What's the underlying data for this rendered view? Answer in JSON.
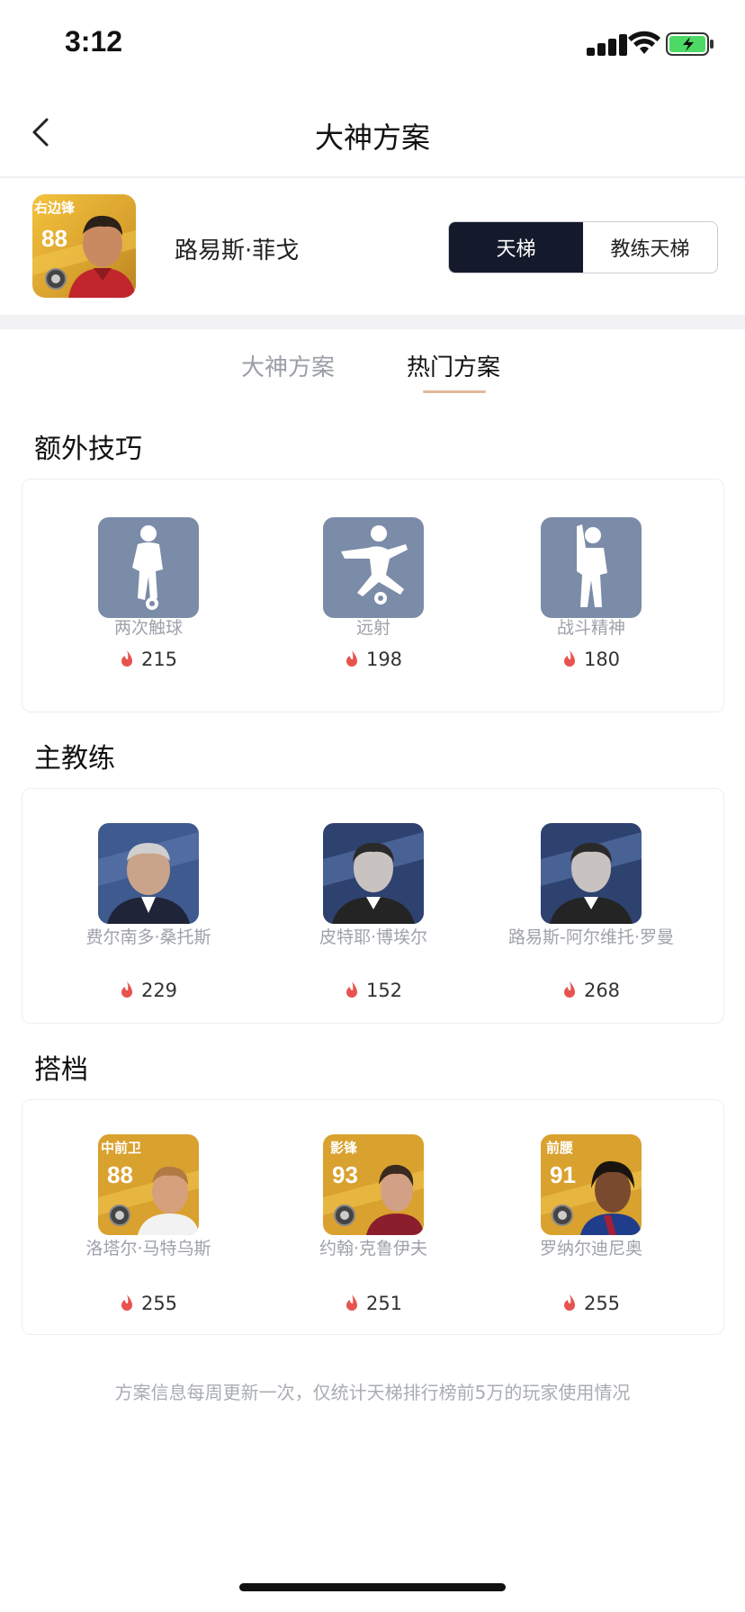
{
  "status": {
    "time": "3:12"
  },
  "nav": {
    "title": "大神方案"
  },
  "player": {
    "name": "路易斯·菲戈",
    "position": "右边锋",
    "rating": "88",
    "segments": [
      "天梯",
      "教练天梯"
    ],
    "active_segment": "天梯"
  },
  "tabs": [
    {
      "label": "大神方案",
      "active": false
    },
    {
      "label": "热门方案",
      "active": true
    }
  ],
  "sections": {
    "skills": {
      "title": "额外技巧",
      "items": [
        {
          "label": "两次触球",
          "count": "215",
          "icon": "dribble-player-icon"
        },
        {
          "label": "远射",
          "count": "198",
          "icon": "kicking-player-icon"
        },
        {
          "label": "战斗精神",
          "count": "180",
          "icon": "fighting-spirit-player-icon"
        }
      ]
    },
    "coaches": {
      "title": "主教练",
      "items": [
        {
          "label": "费尔南多·桑托斯",
          "count": "229"
        },
        {
          "label": "皮特耶·博埃尔",
          "count": "152"
        },
        {
          "label": "路易斯-阿尔维托·罗曼",
          "count": "268"
        }
      ]
    },
    "partners": {
      "title": "搭档",
      "items": [
        {
          "label": "洛塔尔·马特乌斯",
          "count": "255",
          "position": "中前卫",
          "rating": "88"
        },
        {
          "label": "约翰·克鲁伊夫",
          "count": "251",
          "position": "影锋",
          "rating": "93"
        },
        {
          "label": "罗纳尔迪尼奥",
          "count": "255",
          "position": "前腰",
          "rating": "91"
        }
      ]
    }
  },
  "footer": {
    "note": "方案信息每周更新一次，仅统计天梯排行榜前5万的玩家使用情况"
  },
  "colors": {
    "accent_dark": "#141a2b",
    "flame": "#e8534f",
    "skill_tile": "#7b8ca8",
    "tab_underline": "#e3b99a",
    "card_gold": "#d9a12e"
  }
}
